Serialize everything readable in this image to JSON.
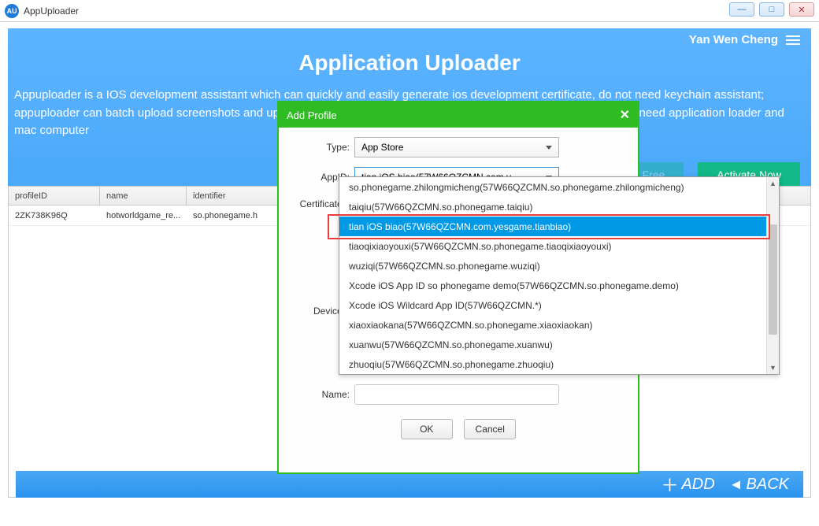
{
  "titlebar": {
    "appname": "AppUploader",
    "logo_text": "AU"
  },
  "user": {
    "name": "Yan Wen Cheng"
  },
  "app": {
    "title": "Application Uploader",
    "desc": "Appuploader is a IOS development assistant which can quickly and easily generate ios development certificate, do not need keychain assistant; appuploader can batch upload screenshots and upload IPA to apple store; It can work on windows, linux or mac, do not need application loader and mac computer"
  },
  "buttons": {
    "download_pc": "Download PC Free",
    "activate": "Activate Now"
  },
  "table": {
    "headers": [
      "profileID",
      "name",
      "identifier"
    ],
    "row": {
      "profileID": "2ZK738K96Q",
      "name": "hotworldgame_re...",
      "identifier": "so.phonegame.h"
    }
  },
  "modal": {
    "title": "Add Profile",
    "labels": {
      "type": "Type:",
      "appid": "AppID:",
      "certificates": "Certificates:",
      "devices": "Devices:",
      "name": "Name:"
    },
    "type_value": "App Store",
    "appid_value": "tian iOS biao(57W66QZCMN.com.y...",
    "ok": "OK",
    "cancel": "Cancel"
  },
  "dropdown": {
    "items": [
      "so.phonegame.zhilongmicheng(57W66QZCMN.so.phonegame.zhilongmicheng)",
      "taiqiu(57W66QZCMN.so.phonegame.taiqiu)",
      "tian iOS biao(57W66QZCMN.com.yesgame.tianbiao)",
      "tiaoqixiaoyouxi(57W66QZCMN.so.phonegame.tiaoqixiaoyouxi)",
      "wuziqi(57W66QZCMN.so.phonegame.wuziqi)",
      "Xcode iOS App ID so phonegame demo(57W66QZCMN.so.phonegame.demo)",
      "Xcode iOS Wildcard App ID(57W66QZCMN.*)",
      "xiaoxiaokana(57W66QZCMN.so.phonegame.xiaoxiaokan)",
      "xuanwu(57W66QZCMN.so.phonegame.xuanwu)",
      "zhuoqiu(57W66QZCMN.so.phonegame.zhuoqiu)"
    ],
    "selected_index": 2
  },
  "footer": {
    "add": "ADD",
    "back": "BACK"
  }
}
